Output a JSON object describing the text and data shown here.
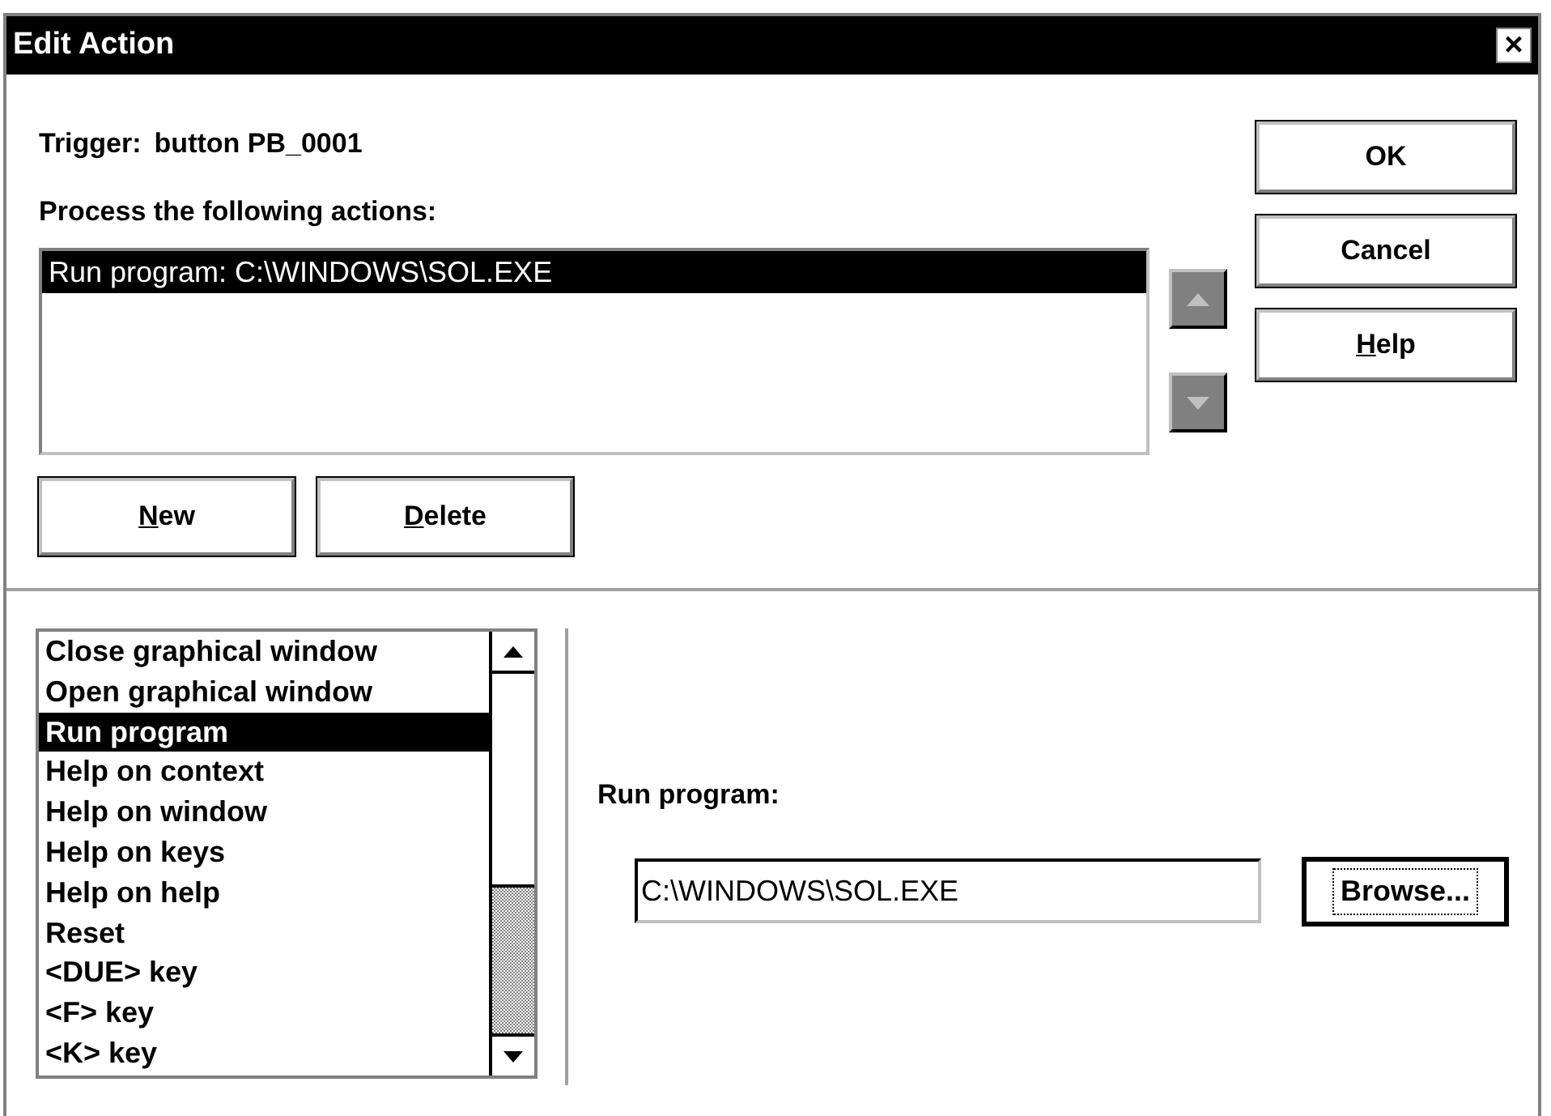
{
  "window": {
    "title": "Edit Action",
    "close_button": "×"
  },
  "trigger": {
    "label": "Trigger:",
    "value": "button PB_0001"
  },
  "actions_label": "Process the following actions:",
  "actions": [
    {
      "text": "Run program: C:\\WINDOWS\\SOL.EXE",
      "selected": true
    }
  ],
  "dialog_buttons": [
    {
      "label": "OK",
      "underline_first": false
    },
    {
      "label": "Cancel",
      "underline_first": false
    },
    {
      "label": "Help",
      "underline_first": true
    }
  ],
  "list_buttons": [
    {
      "label": "New",
      "underline_first": true
    },
    {
      "label": "Delete",
      "underline_first": true
    }
  ],
  "action_types": [
    {
      "text": "Close graphical window",
      "selected": false
    },
    {
      "text": "Open graphical window",
      "selected": false
    },
    {
      "text": "Run program",
      "selected": true
    },
    {
      "text": "Help on context",
      "selected": false
    },
    {
      "text": "Help on window",
      "selected": false
    },
    {
      "text": "Help on keys",
      "selected": false
    },
    {
      "text": "Help on help",
      "selected": false
    },
    {
      "text": "Reset",
      "selected": false
    },
    {
      "text": "<DUE> key",
      "selected": false
    },
    {
      "text": "<F> key",
      "selected": false
    },
    {
      "text": "<K> key",
      "selected": false
    }
  ],
  "program": {
    "label": "Run program:",
    "value": "C:\\WINDOWS\\SOL.EXE",
    "browse_button": "Browse..."
  }
}
